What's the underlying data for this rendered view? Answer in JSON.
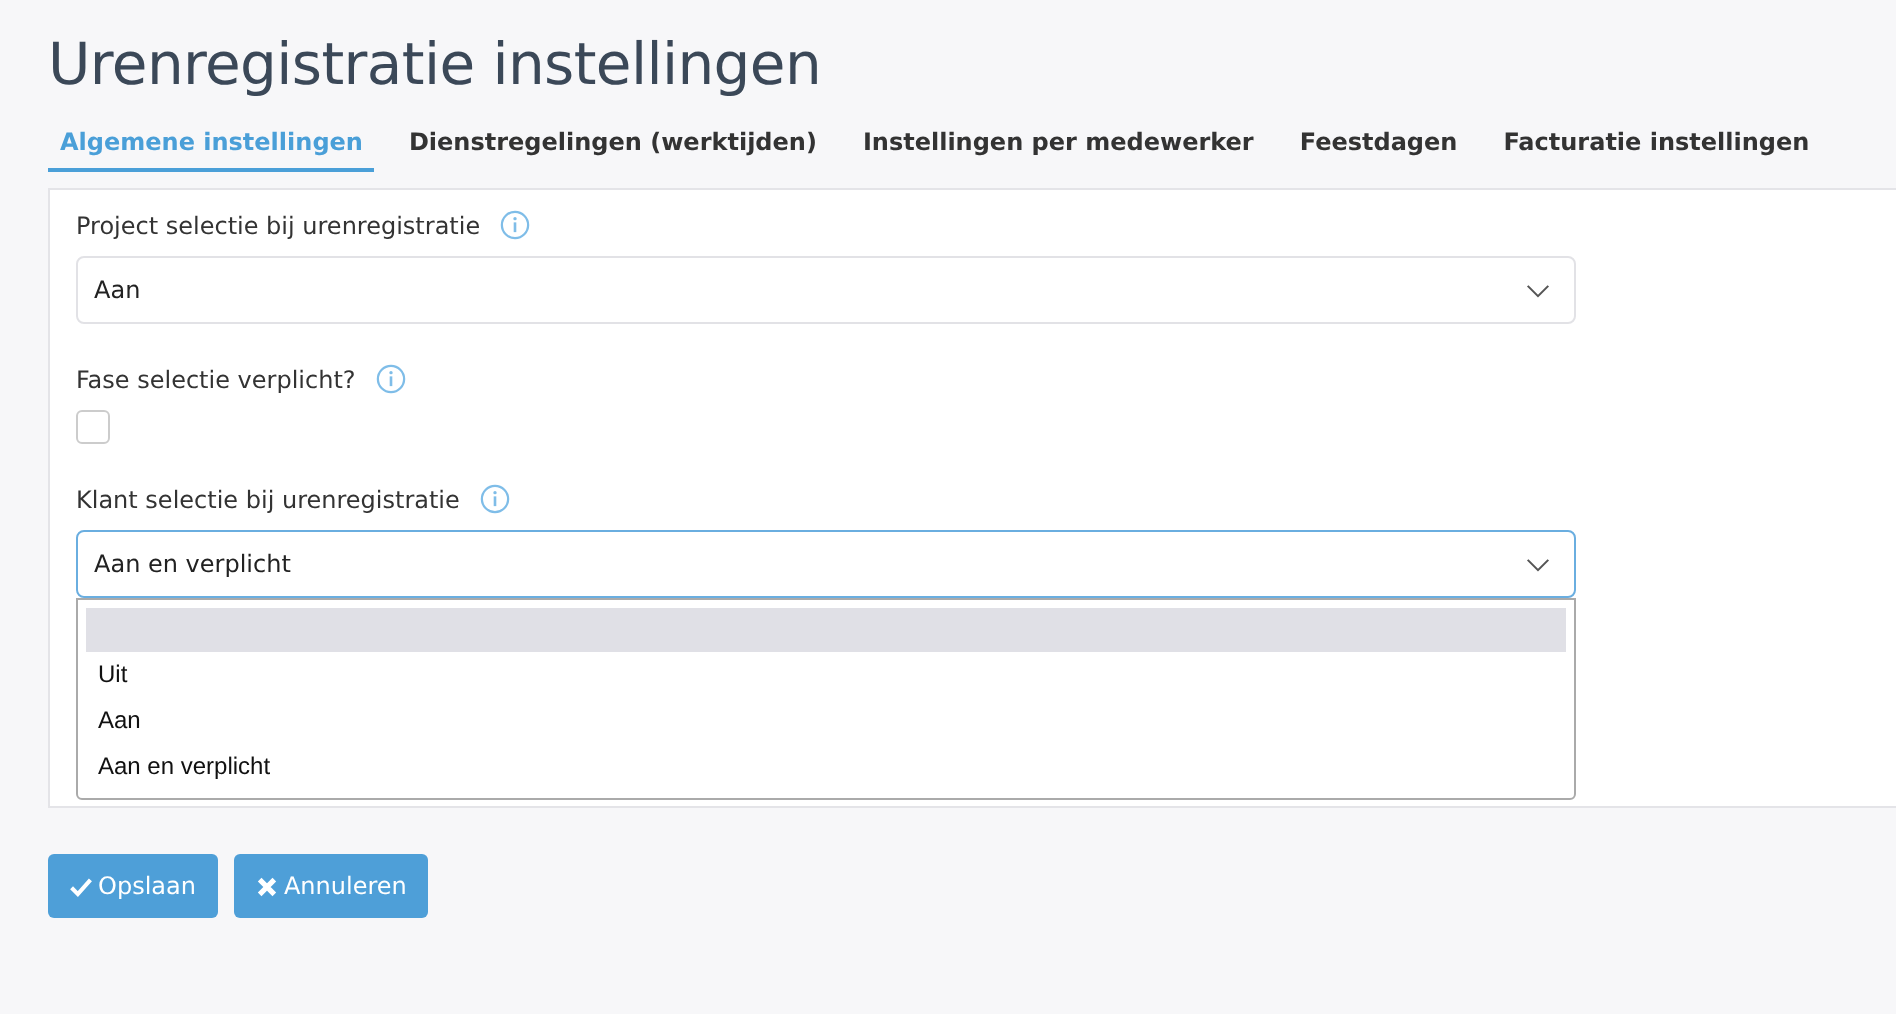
{
  "title": "Urenregistratie instellingen",
  "tabs": [
    {
      "label": "Algemene instellingen",
      "selected": true
    },
    {
      "label": "Dienstregelingen (werktijden)",
      "selected": false
    },
    {
      "label": "Instellingen per medewerker",
      "selected": false
    },
    {
      "label": "Feestdagen",
      "selected": false
    },
    {
      "label": "Facturatie instellingen",
      "selected": false
    }
  ],
  "fields": [
    {
      "kind": "select",
      "label": "Project selectie bij urenregistratie",
      "value": "Aan",
      "focused": false
    },
    {
      "kind": "checkbox",
      "label": "Fase selectie verplicht?",
      "checked": false
    },
    {
      "kind": "select",
      "label": "Klant selectie bij urenregistratie",
      "value": "Aan en verplicht",
      "focused": true,
      "dropdown": {
        "blank_option": {
          "highlighted": true
        },
        "options": [
          {
            "label": "Uit",
            "highlighted": false
          },
          {
            "label": "Aan",
            "highlighted": false
          },
          {
            "label": "Aan en verplicht",
            "highlighted": false
          }
        ]
      }
    }
  ],
  "buttons": [
    {
      "kind": "save",
      "label": "Opslaan"
    },
    {
      "kind": "cancel",
      "label": "Annuleren"
    }
  ]
}
